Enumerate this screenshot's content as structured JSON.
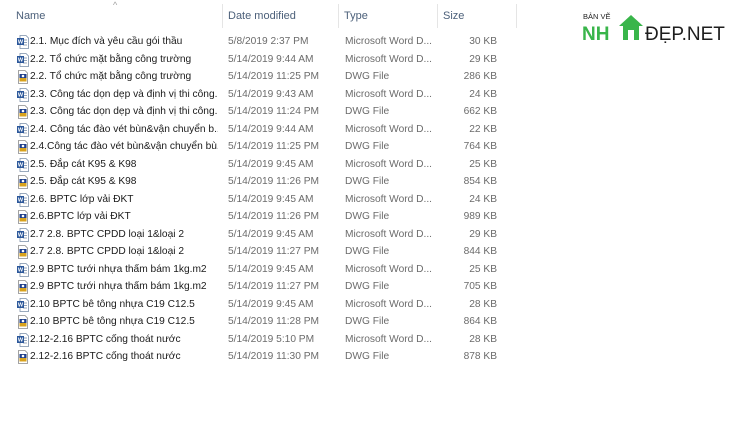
{
  "columns": {
    "name": "Name",
    "date": "Date modified",
    "type": "Type",
    "size": "Size"
  },
  "sort_indicator": "^",
  "files": [
    {
      "icon": "word-doc-icon",
      "name": "2.1. Mục đích và yêu cầu gói thầu",
      "date": "5/8/2019 2:37 PM",
      "type": "Microsoft Word D...",
      "size": "30 KB"
    },
    {
      "icon": "word-doc-icon",
      "name": "2.2. Tổ chức mặt bằng công trường",
      "date": "5/14/2019 9:44 AM",
      "type": "Microsoft Word D...",
      "size": "29 KB"
    },
    {
      "icon": "dwg-file-icon",
      "name": "2.2. Tổ chức mặt bằng công trường",
      "date": "5/14/2019 11:25 PM",
      "type": "DWG File",
      "size": "286 KB"
    },
    {
      "icon": "word-doc-icon",
      "name": "2.3. Công tác dọn dẹp và định vị thi công...",
      "date": "5/14/2019 9:43 AM",
      "type": "Microsoft Word D...",
      "size": "24 KB"
    },
    {
      "icon": "dwg-file-icon",
      "name": "2.3. Công tác dọn dẹp và định vị thi công...",
      "date": "5/14/2019 11:24 PM",
      "type": "DWG File",
      "size": "662 KB"
    },
    {
      "icon": "word-doc-icon",
      "name": "2.4. Công tác đào vét bùn&vận chuyển b...",
      "date": "5/14/2019 9:44 AM",
      "type": "Microsoft Word D...",
      "size": "22 KB"
    },
    {
      "icon": "dwg-file-icon",
      "name": "2.4.Công tác đào vét bùn&vận chuyển bù...",
      "date": "5/14/2019 11:25 PM",
      "type": "DWG File",
      "size": "764 KB"
    },
    {
      "icon": "word-doc-icon",
      "name": "2.5. Đắp cát K95 & K98",
      "date": "5/14/2019 9:45 AM",
      "type": "Microsoft Word D...",
      "size": "25 KB"
    },
    {
      "icon": "dwg-file-icon",
      "name": "2.5. Đắp cát K95 & K98",
      "date": "5/14/2019 11:26 PM",
      "type": "DWG File",
      "size": "854 KB"
    },
    {
      "icon": "word-doc-icon",
      "name": "2.6. BPTC lớp vải ĐKT",
      "date": "5/14/2019 9:45 AM",
      "type": "Microsoft Word D...",
      "size": "24 KB"
    },
    {
      "icon": "dwg-file-icon",
      "name": "2.6.BPTC lớp vải ĐKT",
      "date": "5/14/2019 11:26 PM",
      "type": "DWG File",
      "size": "989 KB"
    },
    {
      "icon": "word-doc-icon",
      "name": "2.7 2.8. BPTC CPDD loại 1&loại 2",
      "date": "5/14/2019 9:45 AM",
      "type": "Microsoft Word D...",
      "size": "29 KB"
    },
    {
      "icon": "dwg-file-icon",
      "name": "2.7 2.8. BPTC CPDD loại 1&loại 2",
      "date": "5/14/2019 11:27 PM",
      "type": "DWG File",
      "size": "844 KB"
    },
    {
      "icon": "word-doc-icon",
      "name": "2.9 BPTC tưới nhựa thấm bám 1kg.m2",
      "date": "5/14/2019 9:45 AM",
      "type": "Microsoft Word D...",
      "size": "25 KB"
    },
    {
      "icon": "dwg-file-icon",
      "name": "2.9 BPTC tưới nhựa thấm bám 1kg.m2",
      "date": "5/14/2019 11:27 PM",
      "type": "DWG File",
      "size": "705 KB"
    },
    {
      "icon": "word-doc-icon",
      "name": "2.10 BPTC bê tông nhựa C19 C12.5",
      "date": "5/14/2019 9:45 AM",
      "type": "Microsoft Word D...",
      "size": "28 KB"
    },
    {
      "icon": "dwg-file-icon",
      "name": "2.10 BPTC bê tông nhựa C19 C12.5",
      "date": "5/14/2019 11:28 PM",
      "type": "DWG File",
      "size": "864 KB"
    },
    {
      "icon": "word-doc-icon",
      "name": "2.12-2.16 BPTC cống thoát nước",
      "date": "5/14/2019 5:10 PM",
      "type": "Microsoft Word D...",
      "size": "28 KB"
    },
    {
      "icon": "dwg-file-icon",
      "name": "2.12-2.16 BPTC cống thoát nước",
      "date": "5/14/2019 11:30 PM",
      "type": "DWG File",
      "size": "878 KB"
    }
  ],
  "logo": {
    "top": "BẢN VẼ",
    "left": "NH",
    "right": "ĐẸP.NET",
    "green": "#39b54a",
    "dark": "#1e1e1e"
  }
}
